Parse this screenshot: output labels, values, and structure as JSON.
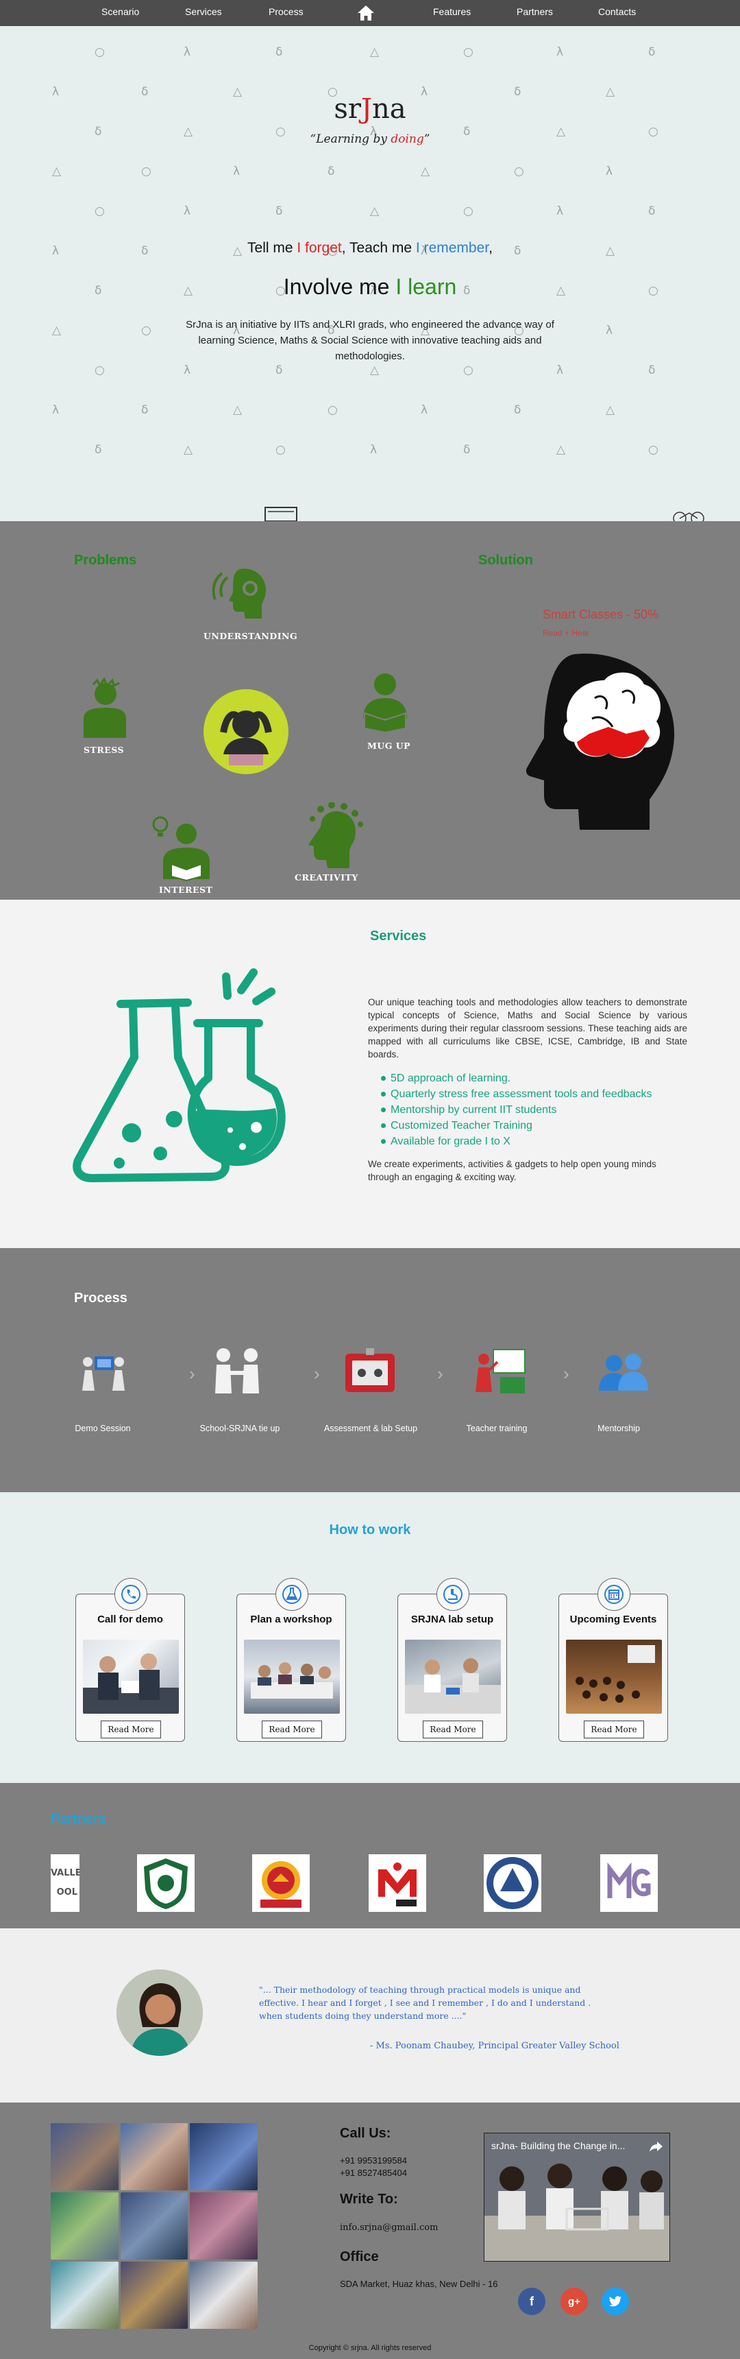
{
  "nav": {
    "items": [
      "Scenario",
      "Services",
      "Process",
      "Features",
      "Partners",
      "Contacts"
    ],
    "home_icon": "home-icon"
  },
  "social": [
    "facebook-icon",
    "twitter-icon",
    "google-plus-icon"
  ],
  "hero": {
    "logo": {
      "pre": "sr",
      "mid": "J",
      "post": "na"
    },
    "tagline": {
      "quote_open": "“",
      "pre": "Learning by ",
      "doing": "doing",
      "quote_close": "”"
    },
    "tell": {
      "a": "Tell me ",
      "b": "I forget",
      "c": ", Teach me ",
      "d": "I remember",
      "e": ","
    },
    "involve": {
      "a": "Involve me ",
      "b": "I learn"
    },
    "description": "SrJna is an initiative by IITs and XLRI grads, who engineered the advance way of learning Science, Maths & Social Science with innovative teaching aids and methodologies."
  },
  "problems": {
    "title": "Problems",
    "labels": [
      "UNDERSTANDING",
      "STRESS",
      "MUG UP",
      "INTEREST",
      "CREATIVITY"
    ],
    "solution_title": "Solution",
    "smart": "Smart Classes - 50%",
    "read_hear": "Read + Hear"
  },
  "services": {
    "title": "Services",
    "description": "Our unique teaching tools and methodologies allow teachers to demonstrate typical concepts of Science, Maths and Social Science by various experiments during their regular classroom sessions. These teaching aids are mapped with all curriculums like CBSE, ICSE, Cambridge, IB and State boards.",
    "list": [
      "5D approach of learning.",
      "Quarterly stress free assessment tools and feedbacks",
      "Mentorship by current IIT students",
      "Customized Teacher Training",
      "Available for grade I to X"
    ],
    "footer": "We create experiments, activities & gadgets to help open young minds through an engaging & exciting way."
  },
  "process": {
    "title": "Process",
    "steps": [
      "Demo Session",
      "School-SRJNA tie up",
      "Assessment & lab Setup",
      "Teacher training",
      "Mentorship"
    ]
  },
  "how": {
    "title": "How to work",
    "cards": [
      {
        "title": "Call for demo",
        "button": "Read More",
        "icon": "phone-icon"
      },
      {
        "title": "Plan a workshop",
        "button": "Read More",
        "icon": "flask-icon"
      },
      {
        "title": "SRJNA lab setup",
        "button": "Read More",
        "icon": "microscope-icon"
      },
      {
        "title": "Upcoming Events",
        "button": "Read More",
        "icon": "calendar-icon"
      }
    ]
  },
  "partners": {
    "title": "Partners",
    "logo_first_text": "VALLEY\nOOL"
  },
  "testimonial": {
    "quote": "\"... Their methodology of teaching through practical models is unique and effective. I hear and I forget , I see and I remember , I do and I understand . when students doing they understand more ....\"",
    "author": "- Ms. Poonam Chaubey, Principal Greater Valley School"
  },
  "footer": {
    "call_title": "Call Us:",
    "phones": [
      "+91 9953199584",
      "+91 8527485404"
    ],
    "write_title": "Write To:",
    "email": "info.srjna@gmail.com",
    "office_title": "Office",
    "address": "SDA Market, Huaz khas, New Delhi - 16",
    "video_title": "srJna- Building the Change in...",
    "copyright": "Copyright © srjna. All rights reserved"
  },
  "colors": {
    "nav_bg": "#4d4d4d",
    "gray_section": "#7f7f7f",
    "green_icon": "#3f7a1c",
    "services_green": "#16a37f",
    "heading_blue": "#1fa3d8",
    "brand_red": "#d62020"
  }
}
